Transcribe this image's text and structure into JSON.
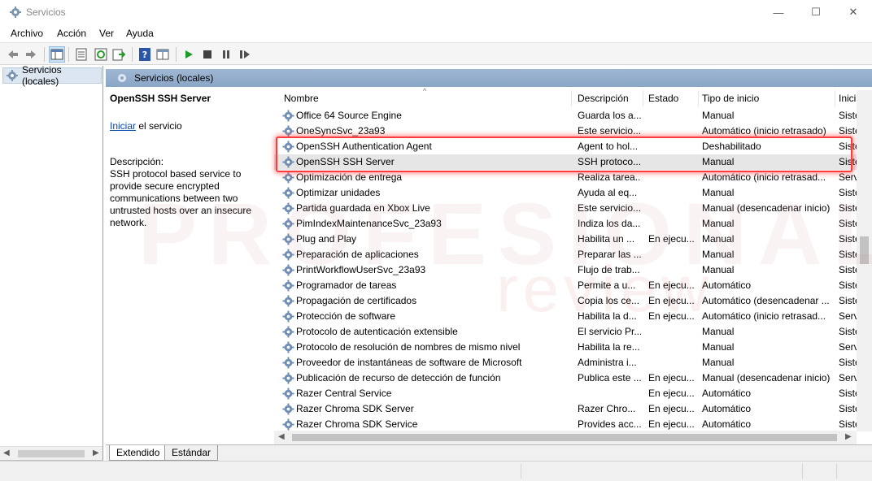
{
  "window": {
    "title": "Servicios",
    "controls": {
      "minimize": "—",
      "maximize": "☐",
      "close": "✕"
    }
  },
  "menu": [
    "Archivo",
    "Acción",
    "Ver",
    "Ayuda"
  ],
  "toolbar": {
    "icons": [
      "back-icon",
      "forward-icon",
      "console-tree-icon",
      "properties-icon",
      "refresh-icon",
      "export-list-icon",
      "help-icon",
      "view-icon",
      "start-service-icon",
      "stop-service-icon",
      "pause-service-icon",
      "restart-service-icon"
    ]
  },
  "tree": {
    "root_label": "Servicios (locales)"
  },
  "pane_header": "Servicios (locales)",
  "info_panel": {
    "service_title": "OpenSSH SSH Server",
    "start_link": "Iniciar",
    "start_suffix": " el servicio",
    "description_label": "Descripción:",
    "description_text": "SSH protocol based service to provide secure encrypted communications between two untrusted hosts over an insecure network."
  },
  "columns": {
    "name": "Nombre",
    "description": "Descripción",
    "state": "Estado",
    "start_type": "Tipo de inicio",
    "logon": "Inici"
  },
  "rows": [
    {
      "name": "Office 64 Source Engine",
      "description": "Guarda los a...",
      "state": "",
      "start_type": "Manual",
      "logon": "Siste"
    },
    {
      "name": "OneSyncSvc_23a93",
      "description": "Este servicio...",
      "state": "",
      "start_type": "Automático (inicio retrasado)",
      "logon": "Siste"
    },
    {
      "name": "OpenSSH Authentication Agent",
      "description": "Agent to hol...",
      "state": "",
      "start_type": "Deshabilitado",
      "logon": "Siste"
    },
    {
      "name": "OpenSSH SSH Server",
      "description": "SSH protoco...",
      "state": "",
      "start_type": "Manual",
      "logon": "Siste",
      "selected": true
    },
    {
      "name": "Optimización de entrega",
      "description": "Realiza tarea...",
      "state": "",
      "start_type": "Automático (inicio retrasad...",
      "logon": "Serv"
    },
    {
      "name": "Optimizar unidades",
      "description": "Ayuda al eq...",
      "state": "",
      "start_type": "Manual",
      "logon": "Siste"
    },
    {
      "name": "Partida guardada en Xbox Live",
      "description": "Este servicio...",
      "state": "",
      "start_type": "Manual (desencadenar inicio)",
      "logon": "Siste"
    },
    {
      "name": "PimIndexMaintenanceSvc_23a93",
      "description": "Indiza los da...",
      "state": "",
      "start_type": "Manual",
      "logon": "Siste"
    },
    {
      "name": "Plug and Play",
      "description": "Habilita un ...",
      "state": "En ejecu...",
      "start_type": "Manual",
      "logon": "Siste"
    },
    {
      "name": "Preparación de aplicaciones",
      "description": "Preparar las ...",
      "state": "",
      "start_type": "Manual",
      "logon": "Siste"
    },
    {
      "name": "PrintWorkflowUserSvc_23a93",
      "description": "Flujo de trab...",
      "state": "",
      "start_type": "Manual",
      "logon": "Siste"
    },
    {
      "name": "Programador de tareas",
      "description": "Permite a u...",
      "state": "En ejecu...",
      "start_type": "Automático",
      "logon": "Siste"
    },
    {
      "name": "Propagación de certificados",
      "description": "Copia los ce...",
      "state": "En ejecu...",
      "start_type": "Automático (desencadenar ...",
      "logon": "Siste"
    },
    {
      "name": "Protección de software",
      "description": "Habilita la d...",
      "state": "En ejecu...",
      "start_type": "Automático (inicio retrasad...",
      "logon": "Serv"
    },
    {
      "name": "Protocolo de autenticación extensible",
      "description": "El servicio Pr...",
      "state": "",
      "start_type": "Manual",
      "logon": "Siste"
    },
    {
      "name": "Protocolo de resolución de nombres de mismo nivel",
      "description": "Habilita la re...",
      "state": "",
      "start_type": "Manual",
      "logon": "Serv"
    },
    {
      "name": "Proveedor de instantáneas de software de Microsoft",
      "description": "Administra i...",
      "state": "",
      "start_type": "Manual",
      "logon": "Siste"
    },
    {
      "name": "Publicación de recurso de detección de función",
      "description": "Publica este ...",
      "state": "En ejecu...",
      "start_type": "Manual (desencadenar inicio)",
      "logon": "Serv"
    },
    {
      "name": "Razer Central Service",
      "description": "",
      "state": "En ejecu...",
      "start_type": "Automático",
      "logon": "Siste"
    },
    {
      "name": "Razer Chroma SDK Server",
      "description": "Razer Chro...",
      "state": "En ejecu...",
      "start_type": "Automático",
      "logon": "Siste"
    },
    {
      "name": "Razer Chroma SDK Service",
      "description": "Provides acc...",
      "state": "En ejecu...",
      "start_type": "Automático",
      "logon": "Siste"
    }
  ],
  "tabs": [
    "Extendido",
    "Estándar"
  ],
  "watermark": {
    "line1": "PROFESIONAL",
    "line2": "review"
  },
  "colors": {
    "header_band": "#8aa6c6",
    "highlight": "#ff3b3b",
    "link": "#0645ad"
  }
}
